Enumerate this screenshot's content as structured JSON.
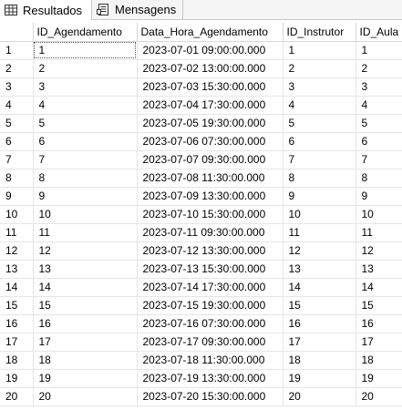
{
  "tabs": [
    {
      "label": "Resultados",
      "icon": "grid-results-icon",
      "active": true
    },
    {
      "label": "Mensagens",
      "icon": "messages-icon",
      "active": false
    }
  ],
  "columns": [
    "ID_Agendamento",
    "Data_Hora_Agendamento",
    "ID_Instrutor",
    "ID_Aula"
  ],
  "rows": [
    {
      "n": "1",
      "id": "1",
      "dt": "2023-07-01 09:00:00.000",
      "instr": "1",
      "aula": "1"
    },
    {
      "n": "2",
      "id": "2",
      "dt": "2023-07-02 13:00:00.000",
      "instr": "2",
      "aula": "2"
    },
    {
      "n": "3",
      "id": "3",
      "dt": "2023-07-03 15:30:00.000",
      "instr": "3",
      "aula": "3"
    },
    {
      "n": "4",
      "id": "4",
      "dt": "2023-07-04 17:30:00.000",
      "instr": "4",
      "aula": "4"
    },
    {
      "n": "5",
      "id": "5",
      "dt": "2023-07-05 19:30:00.000",
      "instr": "5",
      "aula": "5"
    },
    {
      "n": "6",
      "id": "6",
      "dt": "2023-07-06 07:30:00.000",
      "instr": "6",
      "aula": "6"
    },
    {
      "n": "7",
      "id": "7",
      "dt": "2023-07-07 09:30:00.000",
      "instr": "7",
      "aula": "7"
    },
    {
      "n": "8",
      "id": "8",
      "dt": "2023-07-08 11:30:00.000",
      "instr": "8",
      "aula": "8"
    },
    {
      "n": "9",
      "id": "9",
      "dt": "2023-07-09 13:30:00.000",
      "instr": "9",
      "aula": "9"
    },
    {
      "n": "10",
      "id": "10",
      "dt": "2023-07-10 15:30:00.000",
      "instr": "10",
      "aula": "10"
    },
    {
      "n": "11",
      "id": "11",
      "dt": "2023-07-11 09:30:00.000",
      "instr": "11",
      "aula": "11"
    },
    {
      "n": "12",
      "id": "12",
      "dt": "2023-07-12 13:30:00.000",
      "instr": "12",
      "aula": "12"
    },
    {
      "n": "13",
      "id": "13",
      "dt": "2023-07-13 15:30:00.000",
      "instr": "13",
      "aula": "13"
    },
    {
      "n": "14",
      "id": "14",
      "dt": "2023-07-14 17:30:00.000",
      "instr": "14",
      "aula": "14"
    },
    {
      "n": "15",
      "id": "15",
      "dt": "2023-07-15 19:30:00.000",
      "instr": "15",
      "aula": "15"
    },
    {
      "n": "16",
      "id": "16",
      "dt": "2023-07-16 07:30:00.000",
      "instr": "16",
      "aula": "16"
    },
    {
      "n": "17",
      "id": "17",
      "dt": "2023-07-17 09:30:00.000",
      "instr": "17",
      "aula": "17"
    },
    {
      "n": "18",
      "id": "18",
      "dt": "2023-07-18 11:30:00.000",
      "instr": "18",
      "aula": "18"
    },
    {
      "n": "19",
      "id": "19",
      "dt": "2023-07-19 13:30:00.000",
      "instr": "19",
      "aula": "19"
    },
    {
      "n": "20",
      "id": "20",
      "dt": "2023-07-20 15:30:00.000",
      "instr": "20",
      "aula": "20"
    }
  ]
}
